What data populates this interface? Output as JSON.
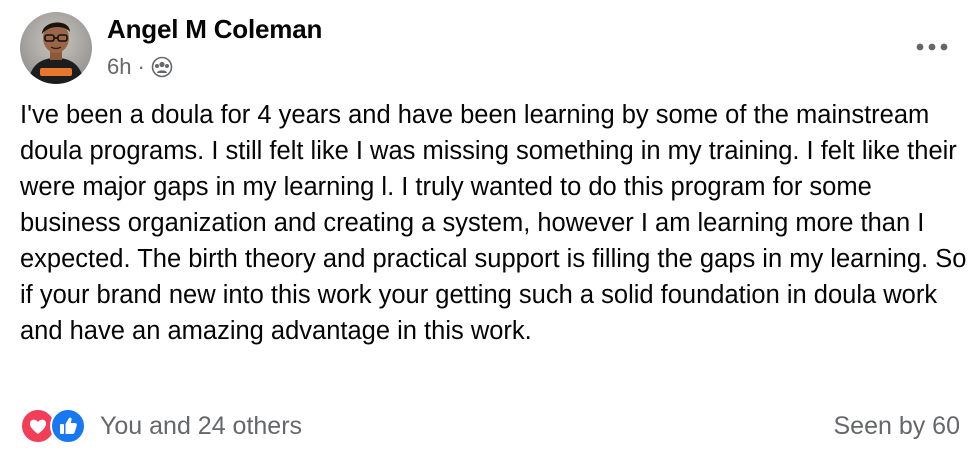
{
  "post": {
    "author": "Angel M Coleman",
    "time": "6h",
    "separator": "·",
    "audience_icon": "friends-group-icon",
    "more_icon": "more-options-icon",
    "text": "I've been a doula for 4 years and have been learning by some of the mainstream doula programs. I still felt like I was missing something in my training. I felt like their were major gaps in my learning l. I truly wanted to do this program for some business organization and creating a system, however I am learning more than I expected. The birth theory and practical support is filling the gaps in my learning. So if your brand new into this work your getting such a solid foundation in doula work and have an amazing advantage in this work."
  },
  "footer": {
    "reaction_icons": [
      "love-reaction-icon",
      "like-reaction-icon"
    ],
    "reactions_text": "You and 24 others",
    "seen_text": "Seen by 60"
  },
  "colors": {
    "text": "#050505",
    "secondary": "#65676b",
    "love": "#f33e58",
    "like": "#1877f2"
  }
}
